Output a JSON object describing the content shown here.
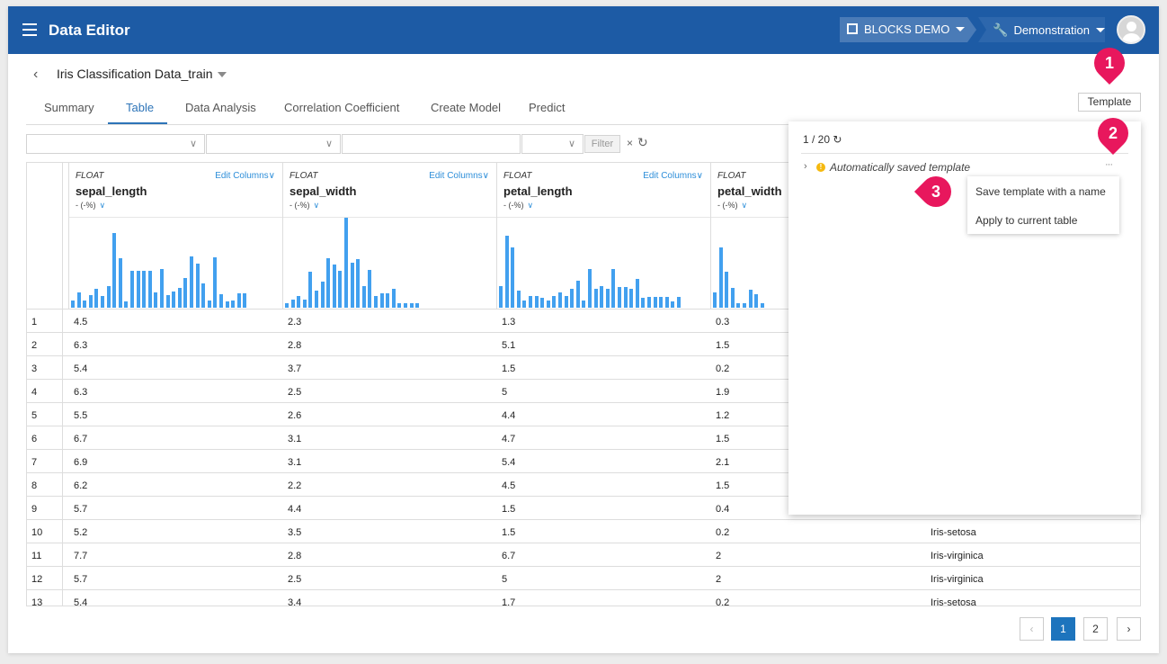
{
  "app": {
    "menu_icon": "hamburger-icon",
    "title": "Data Editor",
    "org": "BLOCKS DEMO",
    "org_icon": "building-icon",
    "project": "Demonstration",
    "project_icon": "wrench-icon",
    "avatar_icon": "user-avatar-icon"
  },
  "dataset": {
    "back_icon": "chevron-left-icon",
    "title": "Iris Classification Data_train"
  },
  "tabs": [
    {
      "label": "Summary",
      "active": false
    },
    {
      "label": "Table",
      "active": true
    },
    {
      "label": "Data Analysis",
      "active": false
    },
    {
      "label": "Correlation Coefficient",
      "active": false
    },
    {
      "label": "Create Model",
      "active": false
    },
    {
      "label": "Predict",
      "active": false
    }
  ],
  "template_button": "Template",
  "filter": {
    "button": "Filter",
    "clear": "×",
    "refresh_icon": "refresh-icon"
  },
  "columns": [
    {
      "type": "FLOAT",
      "name": "sepal_length",
      "null_pct": "- (-%)",
      "edit": "Edit Columns",
      "histogram": [
        8,
        17,
        8,
        14,
        21,
        13,
        24,
        83,
        55,
        7,
        41,
        41,
        41,
        41,
        17,
        43,
        14,
        18,
        22,
        33,
        57,
        49,
        27,
        8,
        56,
        15,
        7,
        8,
        16,
        16
      ]
    },
    {
      "type": "FLOAT",
      "name": "sepal_width",
      "null_pct": "- (-%)",
      "edit": "Edit Columns",
      "histogram": [
        5,
        9,
        13,
        9,
        40,
        19,
        29,
        55,
        48,
        41,
        100,
        50,
        54,
        24,
        42,
        13,
        16,
        16,
        21,
        5,
        5,
        5,
        5
      ]
    },
    {
      "type": "FLOAT",
      "name": "petal_length",
      "null_pct": "- (-%)",
      "edit": "Edit Columns",
      "histogram": [
        24,
        80,
        67,
        19,
        8,
        13,
        13,
        11,
        8,
        13,
        17,
        13,
        21,
        30,
        8,
        43,
        21,
        24,
        21,
        43,
        23,
        23,
        21,
        32,
        11,
        12,
        12,
        12,
        12,
        7,
        12
      ]
    },
    {
      "type": "FLOAT",
      "name": "petal_width",
      "null_pct": "- (-%)",
      "edit": "",
      "histogram": [
        17,
        67,
        40,
        22,
        5,
        5,
        20,
        15,
        5
      ]
    }
  ],
  "rows": [
    {
      "n": "1",
      "c1": "4.5",
      "c2": "2.3",
      "c3": "1.3",
      "c4": "0.3",
      "species": ""
    },
    {
      "n": "2",
      "c1": "6.3",
      "c2": "2.8",
      "c3": "5.1",
      "c4": "1.5",
      "species": ""
    },
    {
      "n": "3",
      "c1": "5.4",
      "c2": "3.7",
      "c3": "1.5",
      "c4": "0.2",
      "species": ""
    },
    {
      "n": "4",
      "c1": "6.3",
      "c2": "2.5",
      "c3": "5",
      "c4": "1.9",
      "species": ""
    },
    {
      "n": "5",
      "c1": "5.5",
      "c2": "2.6",
      "c3": "4.4",
      "c4": "1.2",
      "species": ""
    },
    {
      "n": "6",
      "c1": "6.7",
      "c2": "3.1",
      "c3": "4.7",
      "c4": "1.5",
      "species": ""
    },
    {
      "n": "7",
      "c1": "6.9",
      "c2": "3.1",
      "c3": "5.4",
      "c4": "2.1",
      "species": ""
    },
    {
      "n": "8",
      "c1": "6.2",
      "c2": "2.2",
      "c3": "4.5",
      "c4": "1.5",
      "species": ""
    },
    {
      "n": "9",
      "c1": "5.7",
      "c2": "4.4",
      "c3": "1.5",
      "c4": "0.4",
      "species": ""
    },
    {
      "n": "10",
      "c1": "5.2",
      "c2": "3.5",
      "c3": "1.5",
      "c4": "0.2",
      "species": "Iris-setosa"
    },
    {
      "n": "11",
      "c1": "7.7",
      "c2": "2.8",
      "c3": "6.7",
      "c4": "2",
      "species": "Iris-virginica"
    },
    {
      "n": "12",
      "c1": "5.7",
      "c2": "2.5",
      "c3": "5",
      "c4": "2",
      "species": "Iris-virginica"
    },
    {
      "n": "13",
      "c1": "5.4",
      "c2": "3.4",
      "c3": "1.7",
      "c4": "0.2",
      "species": "Iris-setosa"
    }
  ],
  "template_panel": {
    "count": "1 / 20",
    "refresh_icon": "refresh-icon",
    "item_name": "Automatically saved template",
    "item_more": "···",
    "warning_icon": "warning-icon",
    "menu": [
      "Save template with a name",
      "Apply to current table"
    ]
  },
  "callouts": [
    "1",
    "2",
    "3"
  ],
  "pagination": {
    "prev": "‹",
    "pages": [
      "1",
      "2"
    ],
    "current": "1",
    "next": "›"
  },
  "colors": {
    "appbar": "#1d5ba5",
    "accent": "#2d74b8",
    "histogram": "#42a0ef",
    "callout": "#e8175d",
    "warning": "#f5b90f"
  }
}
